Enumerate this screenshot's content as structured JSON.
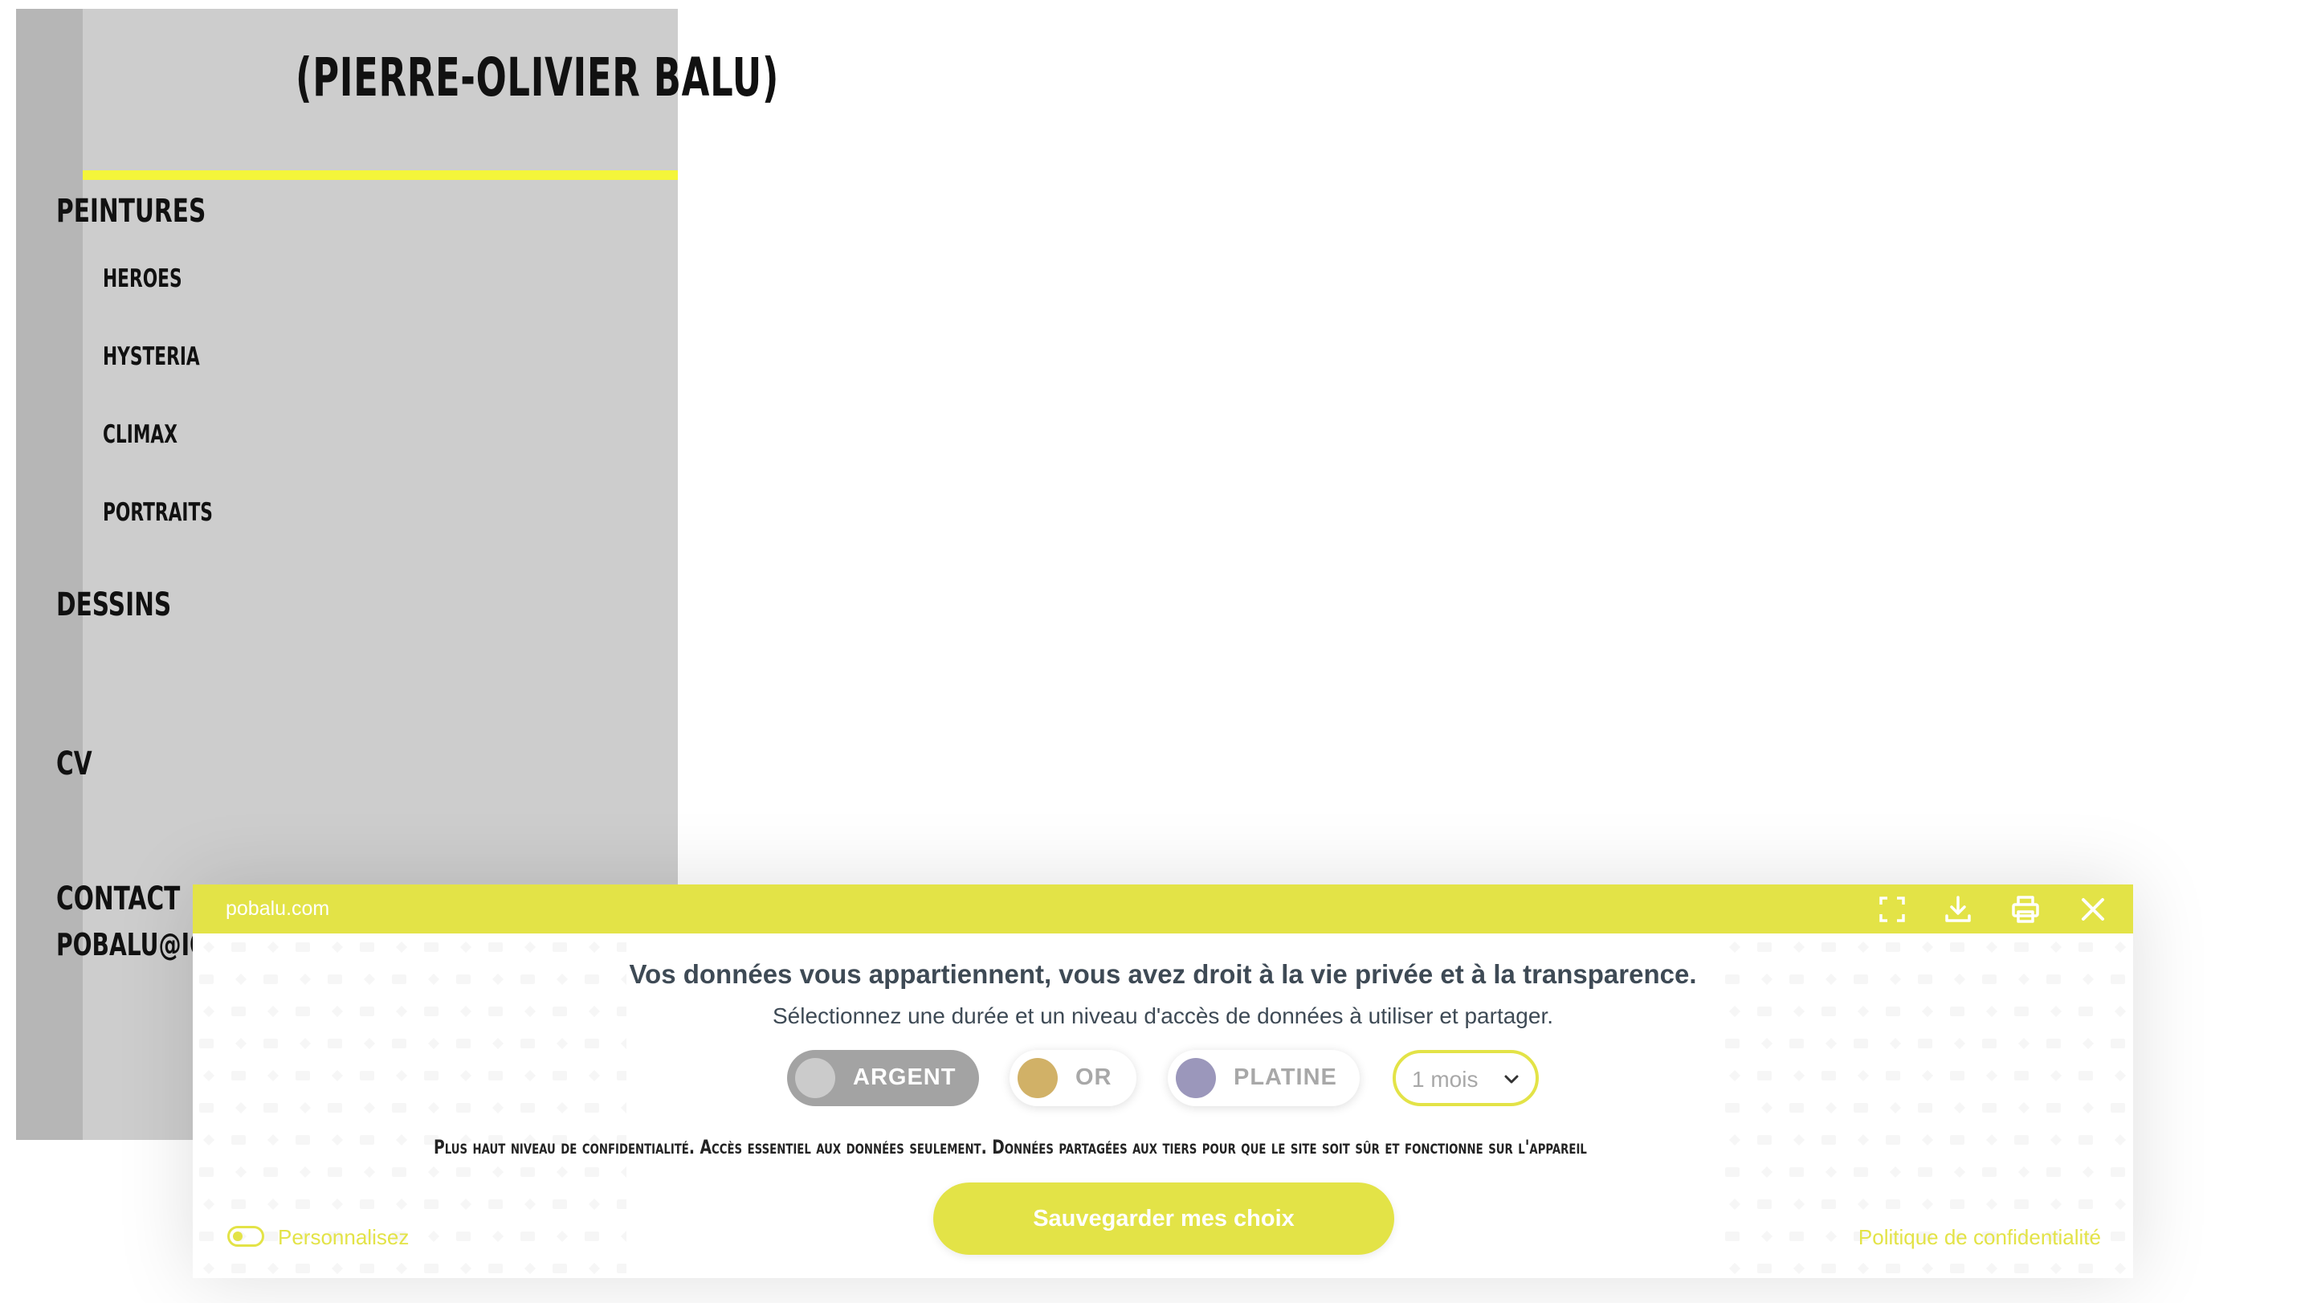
{
  "site": {
    "title": "(PIERRE-OLIVIER  BALU)",
    "accent_color": "#f4f53a",
    "nav": {
      "peintures": "PEINTURES",
      "heroes": "HEROES",
      "hysteria": "HYSTERIA",
      "climax": "CLIMAX",
      "portraits": "PORTRAITS",
      "dessins": "DESSINS",
      "cv": "CV",
      "contact": "CONTACT",
      "email": "POBALU@ICLOUD.COM"
    }
  },
  "consent": {
    "domain": "pobalu.com",
    "brand_color": "#e3e347",
    "icons": [
      "fullscreen-icon",
      "download-icon",
      "print-icon",
      "close-icon"
    ],
    "heading": "Vos données vous appartiennent, vous avez droit à la vie privée et à la transparence.",
    "subheading": "Sélectionnez une durée et un niveau d'accès de données à utiliser et partager.",
    "levels": [
      {
        "label": "ARGENT",
        "selected": true,
        "color": "#a3a3a3"
      },
      {
        "label": "OR",
        "selected": false,
        "color": "#d1b167"
      },
      {
        "label": "PLATINE",
        "selected": false,
        "color": "#9b97bb"
      }
    ],
    "duration": "1 mois",
    "description": "Plus haut niveau de confidentialité. Accès essentiel aux données seulement. Données partagées aux tiers pour que le site soit sûr et fonctionne sur l'appareil",
    "save_label": "Sauvegarder mes choix",
    "customize_label": "Personnalisez",
    "privacy_link": "Politique de confidentialité"
  }
}
